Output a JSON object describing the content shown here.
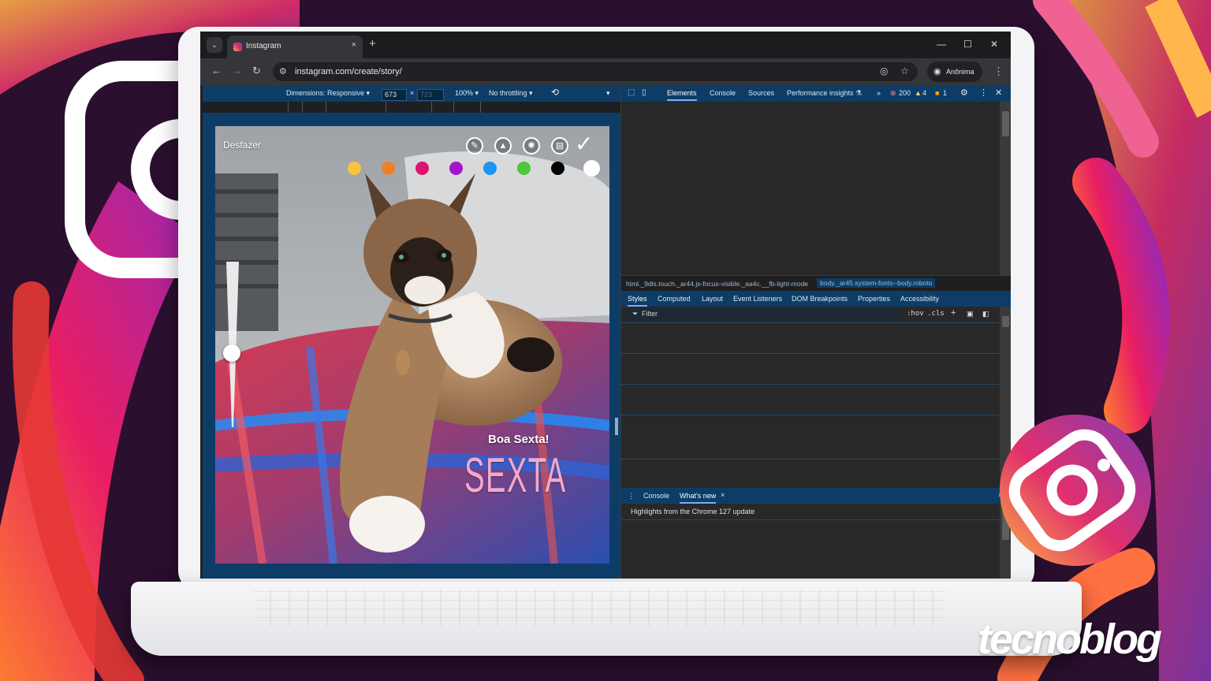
{
  "browser": {
    "tab_title": "Instagram",
    "tab_close": "×",
    "new_tab": "+",
    "window_controls": [
      "—",
      "☐",
      "✕"
    ],
    "url": "instagram.com/create/story/",
    "profile_label": "Anônima"
  },
  "device_toolbar": {
    "dimensions_label": "Dimensions: Responsive ▾",
    "width": "673",
    "times": "×",
    "height": "723",
    "zoom": "100% ▾",
    "throttling": "No throttling ▾",
    "more": "▾"
  },
  "story_editor": {
    "undo_label": "Desfazer",
    "brush_tools": [
      "marker-icon",
      "highlighter-icon",
      "neon-icon",
      "eraser-icon"
    ],
    "colors": [
      "#f9c33c",
      "#f07f2a",
      "#d9156c",
      "#a613c9",
      "#1b93f3",
      "#4cc63b",
      "#000000",
      "#ffffff"
    ],
    "selected_color": "#ffffff",
    "brush_size_fraction": 0.55,
    "text_1": "Boa Sexta!",
    "text_2": "SEXTA"
  },
  "devtools": {
    "tabs": [
      "Elements",
      "Console",
      "Sources",
      "Performance insights ⚗",
      "»"
    ],
    "active_tab": "Elements",
    "errors": "200",
    "warnings": "4",
    "issues": "1",
    "breadcrumb_1": "html._9dls.touch._ar44.js-focus-visible._aa4c.__fb-light-mode",
    "breadcrumb_2": "body._ar45.system-fonts--body.roboto",
    "styles_tabs": [
      "Styles",
      "Computed",
      "Layout",
      "Event Listeners",
      "DOM Breakpoints",
      "Properties",
      "Accessibility"
    ],
    "filter_placeholder": "Filter",
    "hov": ":hov",
    "cls": ".cls",
    "drawer_tabs": [
      "Console",
      "What's new"
    ],
    "drawer_close": "×",
    "whats_new_text": "Highlights from the Chrome 127 update"
  },
  "watermark": "tecnoblog",
  "colors": {
    "devtools_accent": "#0d3d67",
    "background": "#2a0f2e",
    "instagram_gradient": [
      "#fcaf45",
      "#e1306c",
      "#833ab4"
    ]
  }
}
